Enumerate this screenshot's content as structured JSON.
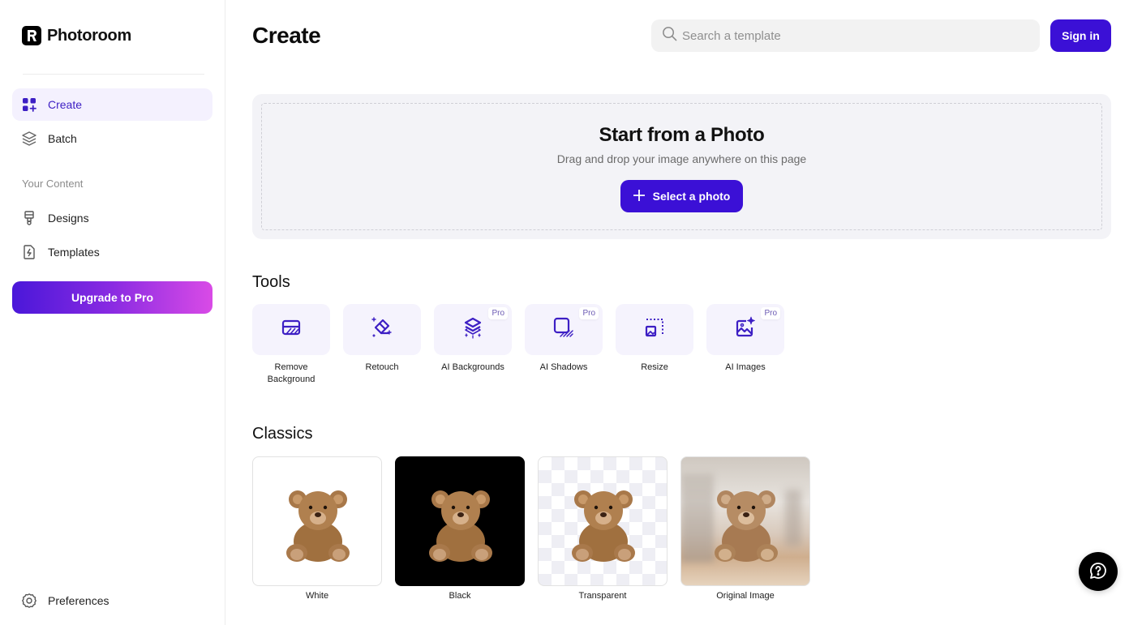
{
  "app": {
    "name": "Photoroom"
  },
  "sidebar": {
    "items": [
      {
        "label": "Create",
        "icon": "grid-plus-icon",
        "active": true
      },
      {
        "label": "Batch",
        "icon": "layers-icon",
        "active": false
      }
    ],
    "section_label": "Your Content",
    "content_items": [
      {
        "label": "Designs",
        "icon": "paintbrush-icon"
      },
      {
        "label": "Templates",
        "icon": "file-bolt-icon"
      }
    ],
    "upgrade_label": "Upgrade to Pro",
    "preferences_label": "Preferences"
  },
  "header": {
    "title": "Create",
    "search_placeholder": "Search a template",
    "signin_label": "Sign in"
  },
  "dropzone": {
    "title": "Start from a Photo",
    "subtitle": "Drag and drop your image anywhere on this page",
    "button_label": "Select a photo"
  },
  "tools": {
    "title": "Tools",
    "items": [
      {
        "label": "Remove Background",
        "icon": "remove-background-icon",
        "pro": false
      },
      {
        "label": "Retouch",
        "icon": "eraser-icon",
        "pro": false
      },
      {
        "label": "AI Backgrounds",
        "icon": "ai-backgrounds-icon",
        "pro": true
      },
      {
        "label": "AI Shadows",
        "icon": "ai-shadows-icon",
        "pro": true
      },
      {
        "label": "Resize",
        "icon": "resize-icon",
        "pro": false
      },
      {
        "label": "AI Images",
        "icon": "ai-images-icon",
        "pro": true
      }
    ],
    "pro_badge": "Pro"
  },
  "classics": {
    "title": "Classics",
    "items": [
      {
        "label": "White"
      },
      {
        "label": "Black"
      },
      {
        "label": "Transparent"
      },
      {
        "label": "Original Image"
      }
    ]
  },
  "colors": {
    "accent": "#3b10d6",
    "active_bg": "#f4f1fe",
    "tool_bg": "#f5f3fd",
    "dropzone_bg": "#f3f3f7"
  }
}
